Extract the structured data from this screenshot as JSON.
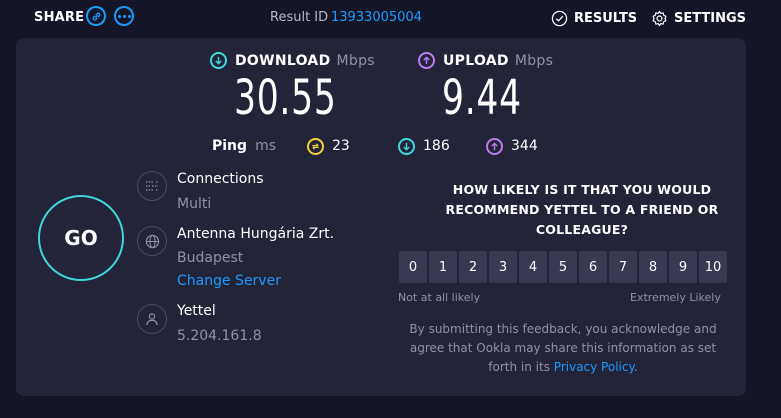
{
  "header": {
    "share_label": "SHARE",
    "result_label": "Result ID",
    "result_id": "13933005004",
    "results_label": "RESULTS",
    "settings_label": "SETTINGS"
  },
  "download": {
    "label": "DOWNLOAD",
    "unit": "Mbps",
    "value": "30.55",
    "color": "#3fd6dc"
  },
  "upload": {
    "label": "UPLOAD",
    "unit": "Mbps",
    "value": "9.44",
    "color": "#bb7cf0"
  },
  "ping": {
    "label": "Ping",
    "unit": "ms",
    "idle": "23",
    "download": "186",
    "upload": "344",
    "idle_color": "#f5d13a"
  },
  "go_label": "GO",
  "connections": {
    "title": "Connections",
    "value": "Multi"
  },
  "server": {
    "name": "Antenna Hungária Zrt.",
    "location": "Budapest",
    "change_label": "Change Server"
  },
  "isp": {
    "name": "Yettel",
    "ip": "5.204.161.8"
  },
  "nps": {
    "question_lines": [
      "HOW LIKELY IS IT THAT YOU WOULD",
      "RECOMMEND YETTEL TO A FRIEND OR",
      "COLLEAGUE?"
    ],
    "scale": [
      "0",
      "1",
      "2",
      "3",
      "4",
      "5",
      "6",
      "7",
      "8",
      "9",
      "10"
    ],
    "low_label": "Not at all likely",
    "high_label": "Extremely Likely",
    "disclaimer_line1": "By submitting this feedback, you acknowledge and",
    "disclaimer_line2": "agree that Ookla may share this information as set",
    "disclaimer_line3_prefix": "forth in its",
    "privacy_link": "Privacy Policy",
    "disclaimer_suffix": "."
  },
  "colors": {
    "accent": "#1c9bff",
    "background": "#141526",
    "card": "#232437"
  }
}
